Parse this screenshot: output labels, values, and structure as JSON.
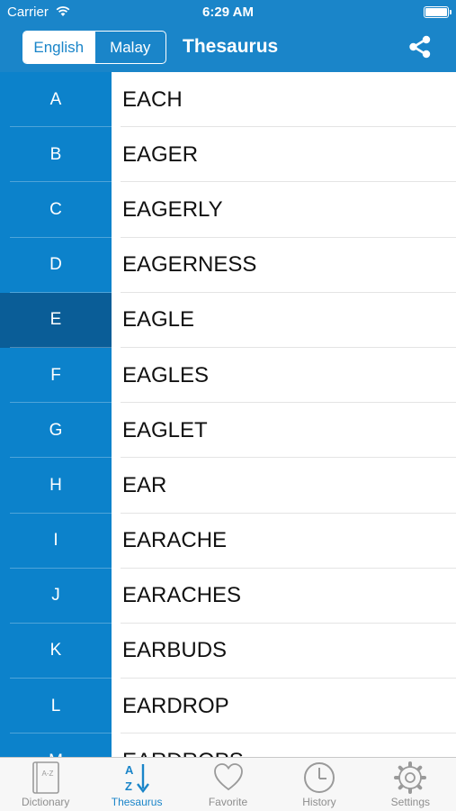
{
  "status_bar": {
    "carrier": "Carrier",
    "time": "6:29 AM"
  },
  "nav": {
    "segments": [
      "English",
      "Malay"
    ],
    "active_segment": "English",
    "title": "Thesaurus",
    "share_icon": "share-icon"
  },
  "alphabet": {
    "letters": [
      "A",
      "B",
      "C",
      "D",
      "E",
      "F",
      "G",
      "H",
      "I",
      "J",
      "K",
      "L",
      "M"
    ],
    "selected": "E"
  },
  "words": [
    "EACH",
    "EAGER",
    "EAGERLY",
    "EAGERNESS",
    "EAGLE",
    "EAGLES",
    "EAGLET",
    "EAR",
    "EARACHE",
    "EARACHES",
    "EARBUDS",
    "EARDROP",
    "EARDROPS"
  ],
  "tabbar": {
    "tabs": [
      {
        "label": "Dictionary",
        "icon": "dictionary-book-icon"
      },
      {
        "label": "Thesaurus",
        "icon": "sort-az-icon"
      },
      {
        "label": "Favorite",
        "icon": "heart-icon"
      },
      {
        "label": "History",
        "icon": "clock-icon"
      },
      {
        "label": "Settings",
        "icon": "gear-icon"
      }
    ],
    "active": "Thesaurus"
  },
  "colors": {
    "header_blue": "#1a85c9",
    "sidebar_blue": "#0c82cb",
    "sidebar_selected": "#0a5d97",
    "tab_active": "#1a85c9",
    "tab_inactive": "#8e8e8e"
  }
}
